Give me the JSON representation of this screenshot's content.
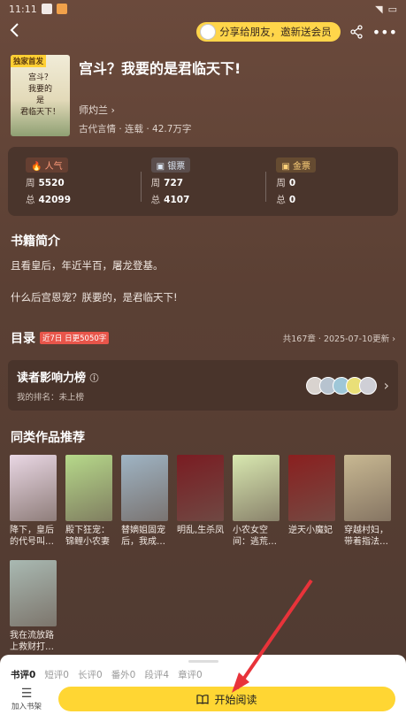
{
  "status_bar": {
    "time": "11:11"
  },
  "nav": {
    "share_label": "分享给朋友，邀新送会员"
  },
  "book": {
    "cover_badge": "独家首发",
    "cover_title_1": "宫斗？",
    "cover_title_2": "我要的",
    "cover_title_3": "是",
    "cover_title_4": "君临天下！",
    "title": "宫斗？我要的是君临天下!",
    "author": "师灼兰",
    "meta": "古代言情 · 连载 · 42.7万字"
  },
  "stats": [
    {
      "label": "人气",
      "icon": "fire-icon",
      "week_label": "周",
      "week": "5520",
      "total_label": "总",
      "total": "42099"
    },
    {
      "label": "银票",
      "icon": "ticket-icon",
      "week_label": "周",
      "week": "727",
      "total_label": "总",
      "total": "4107"
    },
    {
      "label": "金票",
      "icon": "gold-ticket-icon",
      "week_label": "周",
      "week": "0",
      "total_label": "总",
      "total": "0"
    }
  ],
  "synopsis": {
    "title": "书籍简介",
    "line1": "且看皇后，年近半百，屠龙登基。",
    "line2": "什么后宫恩宠？朕要的，是君临天下!"
  },
  "toc": {
    "title": "目录",
    "tag1": "近7日",
    "tag2": "日更5050字",
    "info": "共167章 · 2025-07-10更新"
  },
  "influence": {
    "title": "读者影响力榜",
    "sub": "我的排名：未上榜"
  },
  "recommend": {
    "title": "同类作品推荐",
    "items": [
      {
        "name": "降下，皇后的代号叫…",
        "color": "#e9d7e4"
      },
      {
        "name": "殿下狂宠：锦鲤小农妻",
        "color": "#b6d98a"
      },
      {
        "name": "替嫡姐固宠后，我成…",
        "color": "#9fb4c4"
      },
      {
        "name": "明乱,生杀凤",
        "color": "#7a1c22"
      },
      {
        "name": "小农女空间：逃荒…",
        "color": "#d8e8b0"
      },
      {
        "name": "逆天小魔妃",
        "color": "#8a1f1f"
      },
      {
        "name": "穿越村妇，带着指法…",
        "color": "#c8b892"
      },
      {
        "name": "我在流放路上救财打…",
        "color": "#a9b9b2"
      }
    ]
  },
  "bottom": {
    "tabs": [
      "书评0",
      "短评0",
      "长评0",
      "番外0",
      "段评4",
      "章评0"
    ],
    "shelf_label": "加入书架",
    "read_label": "开始阅读"
  }
}
